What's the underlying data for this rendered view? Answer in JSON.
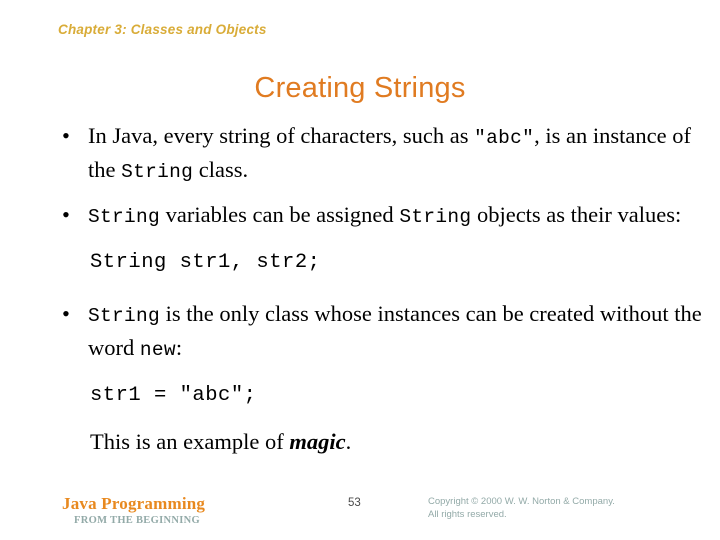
{
  "slide": {
    "chapter_header": "Chapter 3: Classes and Objects",
    "title": "Creating Strings",
    "colors": {
      "header_gold": "#d9ac38",
      "title_orange": "#e07b21",
      "brand_orange": "#e8891f",
      "footer_muted": "#93aaa8",
      "body_text": "#000000",
      "background": "#ffffff"
    }
  },
  "body": {
    "bullet1": {
      "marker": "•",
      "part1": "In Java, every string of characters, such as ",
      "code1": "\"abc\"",
      "part2": ", is an instance of the ",
      "code2": "String",
      "part3": " class."
    },
    "bullet2": {
      "marker": "•",
      "code1": "String",
      "part1": " variables can be assigned ",
      "code2": "String",
      "part2": " objects as their values:"
    },
    "code_line1": "String str1, str2;",
    "bullet3": {
      "marker": "•",
      "code1": "String",
      "part1": " is the only class whose instances can be created without the word ",
      "code2": "new",
      "part2": ":"
    },
    "code_line2": "str1 = \"abc\";",
    "closing": {
      "part1": "This is an example of ",
      "emphasis": "magic",
      "part2": "."
    }
  },
  "footer": {
    "brand": "Java Programming",
    "brand_subtitle": "FROM THE BEGINNING",
    "page_number": "53",
    "copyright_line1": "Copyright © 2000 W. W. Norton & Company.",
    "copyright_line2": "All rights reserved."
  }
}
